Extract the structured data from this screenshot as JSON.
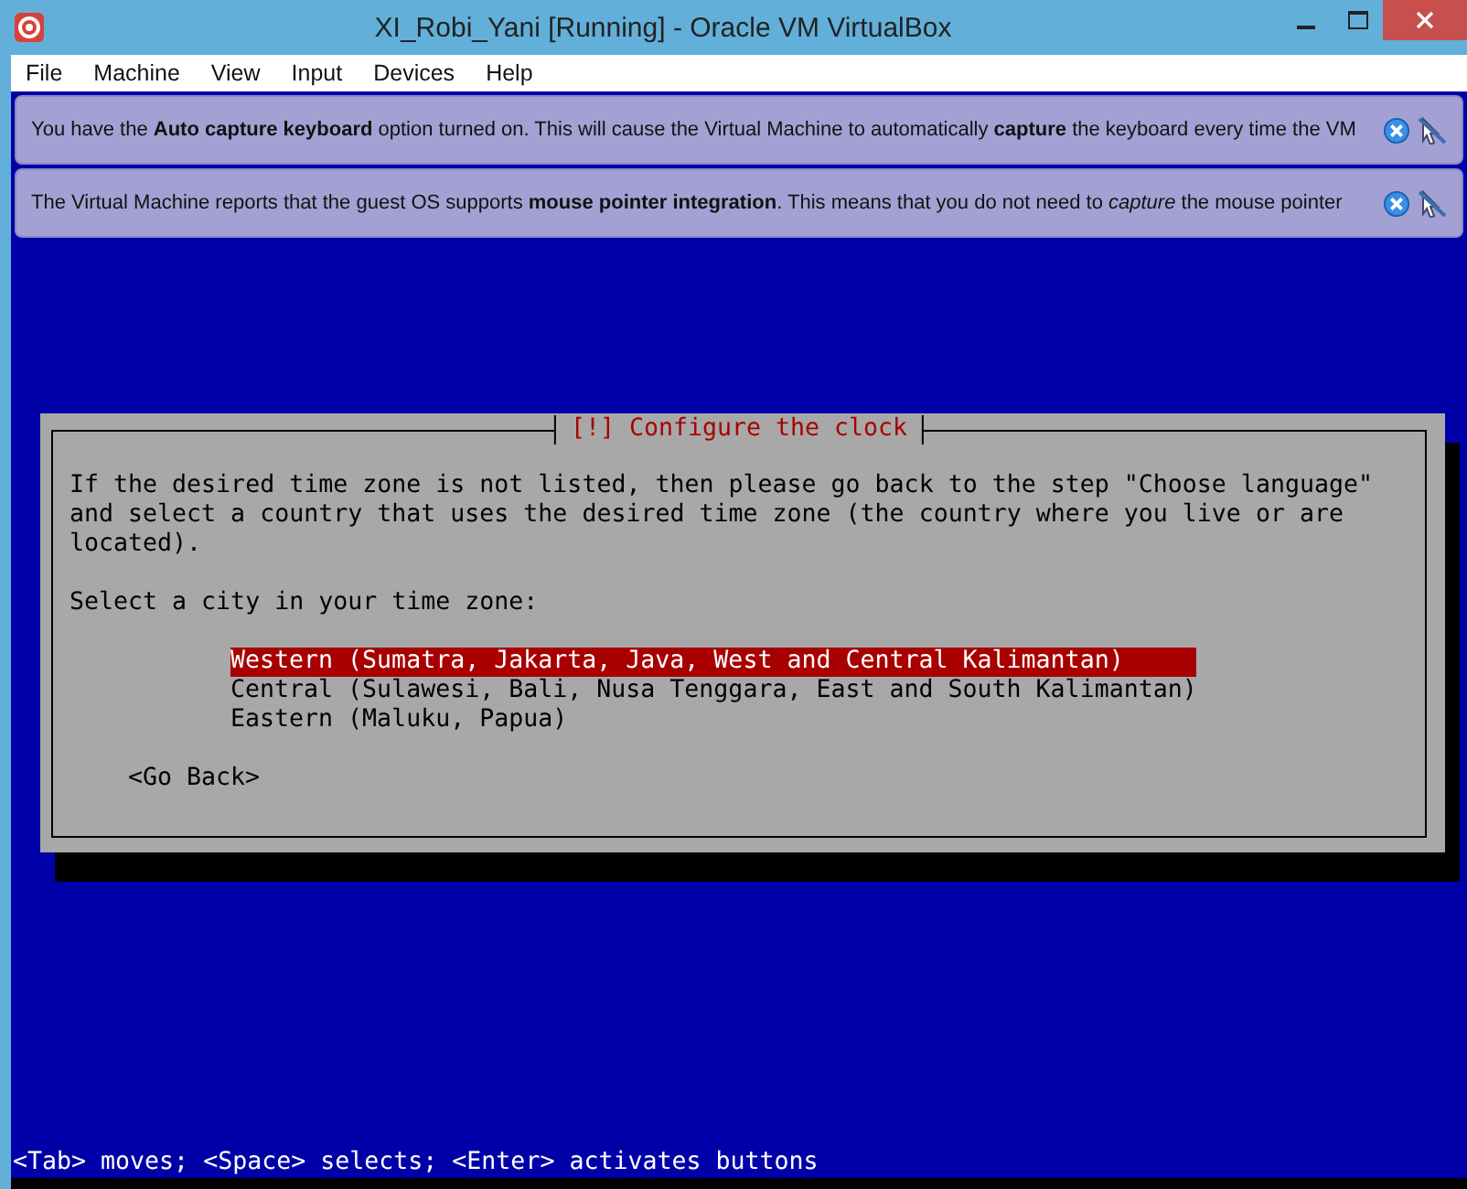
{
  "window": {
    "title": "XI_Robi_Yani [Running] - Oracle VM VirtualBox"
  },
  "menu": [
    "File",
    "Machine",
    "View",
    "Input",
    "Devices",
    "Help"
  ],
  "notifications": [
    {
      "text": "You have the **Auto capture keyboard** option turned on. This will cause the Virtual Machine to automatically **capture** the keyboard every time the VM"
    },
    {
      "text": "The Virtual Machine reports that the guest OS supports **mouse pointer integration**. This means that you do not need to *capture* the mouse pointer"
    }
  ],
  "dialog": {
    "title": "[!] Configure the clock",
    "description": "If the desired time zone is not listed, then please go back to the step \"Choose language\"\nand select a country that uses the desired time zone (the country where you live or are\nlocated).",
    "prompt": "Select a city in your time zone:",
    "options": [
      {
        "label": "Western (Sumatra, Jakarta, Java, West and Central Kalimantan)",
        "selected": true
      },
      {
        "label": "Central (Sulawesi, Bali, Nusa Tenggara, East and South Kalimantan)",
        "selected": false
      },
      {
        "label": "Eastern (Maluku, Papua)",
        "selected": false
      }
    ],
    "back_button": "<Go Back>"
  },
  "status_line": "<Tab> moves; <Space> selects; <Enter> activates buttons"
}
